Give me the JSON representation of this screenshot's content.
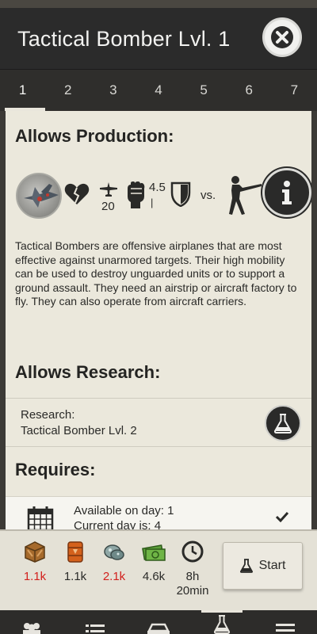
{
  "header": {
    "title": "Tactical Bomber Lvl. 1",
    "close_icon": "close-icon"
  },
  "tabs": [
    {
      "label": "1",
      "active": true
    },
    {
      "label": "2"
    },
    {
      "label": "3"
    },
    {
      "label": "4"
    },
    {
      "label": "5"
    },
    {
      "label": "6"
    },
    {
      "label": "7"
    }
  ],
  "production": {
    "title": "Allows Production:",
    "unit_icon": "tactical-bomber-thumbnail",
    "stats": {
      "health_icon": "broken-heart-icon",
      "speed_value": "20",
      "attack_value": "4.5",
      "attack_sub": "|",
      "defense_icon": "shield-icon",
      "vs_label": "vs.",
      "target_icon": "infantry-soldier-icon"
    },
    "info_icon": "info-icon",
    "description": "Tactical Bombers are offensive airplanes that are most effective against unarmored targets. Their high mobility can be used to destroy unguarded units or to support a ground assault. They need an airstrip or aircraft factory to fly. They can also operate from aircraft carriers."
  },
  "research": {
    "title": "Allows Research:",
    "label": "Research:",
    "name": "Tactical Bomber Lvl. 2",
    "icon": "flask-icon"
  },
  "requires": {
    "title": "Requires:",
    "line1": "Available on day: 1",
    "line2": "Current day is: 4",
    "icon": "calendar-icon",
    "status_icon": "checkmark-icon"
  },
  "costs": [
    {
      "icon": "crate-supplies-icon",
      "value": "1.1k",
      "insufficient": true
    },
    {
      "icon": "fuel-barrel-icon",
      "value": "1.1k",
      "insufficient": false
    },
    {
      "icon": "rare-materials-icon",
      "value": "2.1k",
      "insufficient": true
    },
    {
      "icon": "money-icon",
      "value": "4.6k",
      "insufficient": false
    },
    {
      "icon": "clock-icon",
      "value": "8h 20min",
      "insufficient": false
    }
  ],
  "time": {
    "line1": "8h",
    "line2": "20min"
  },
  "start_button": {
    "label": "Start",
    "icon": "flask-icon"
  },
  "bottom_nav": [
    {
      "icon": "people-icon"
    },
    {
      "icon": "list-icon"
    },
    {
      "icon": "vehicle-icon"
    },
    {
      "icon": "research-flask-icon",
      "active": true
    },
    {
      "icon": "menu-icon"
    }
  ],
  "colors": {
    "header": "#2b2b2b",
    "paper": "#ebe8dc",
    "insufficient": "#d2201d"
  }
}
